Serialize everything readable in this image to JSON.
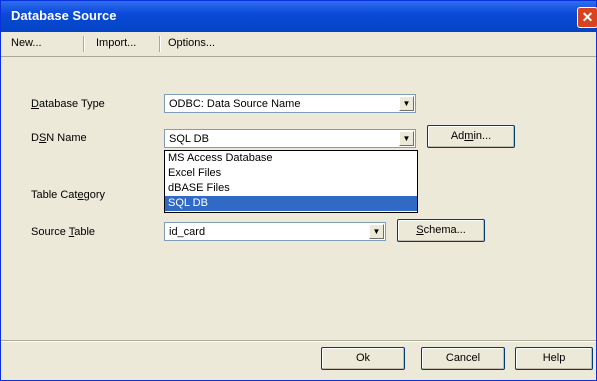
{
  "window": {
    "title": "Database Source",
    "close_glyph": "✕"
  },
  "menu": {
    "new_label": "New...",
    "import_label": "Import...",
    "options_label": "Options..."
  },
  "form": {
    "database_type": {
      "label_pre": "",
      "label_key": "D",
      "label_post": "atabase Type",
      "value": "ODBC: Data Source Name"
    },
    "dsn_name": {
      "label_pre": "D",
      "label_key": "S",
      "label_post": "N Name",
      "value": "SQL DB"
    },
    "admin_button": {
      "pre": "Ad",
      "key": "m",
      "post": "in..."
    },
    "table_category": {
      "label_pre": "Table Cat",
      "label_key": "e",
      "label_post": "gory"
    },
    "source_table": {
      "label_pre": "Source ",
      "label_key": "T",
      "label_post": "able",
      "value": "id_card"
    },
    "schema_button": {
      "pre": "",
      "key": "S",
      "post": "chema..."
    }
  },
  "dsn_dropdown": {
    "options": [
      "MS Access Database",
      "Excel Files",
      "dBASE Files",
      "SQL DB"
    ],
    "selected": "SQL DB"
  },
  "footer": {
    "ok_label": "Ok",
    "cancel_label": "Cancel",
    "help_label": "Help"
  },
  "icons": {
    "dropdown_arrow": "▼"
  }
}
